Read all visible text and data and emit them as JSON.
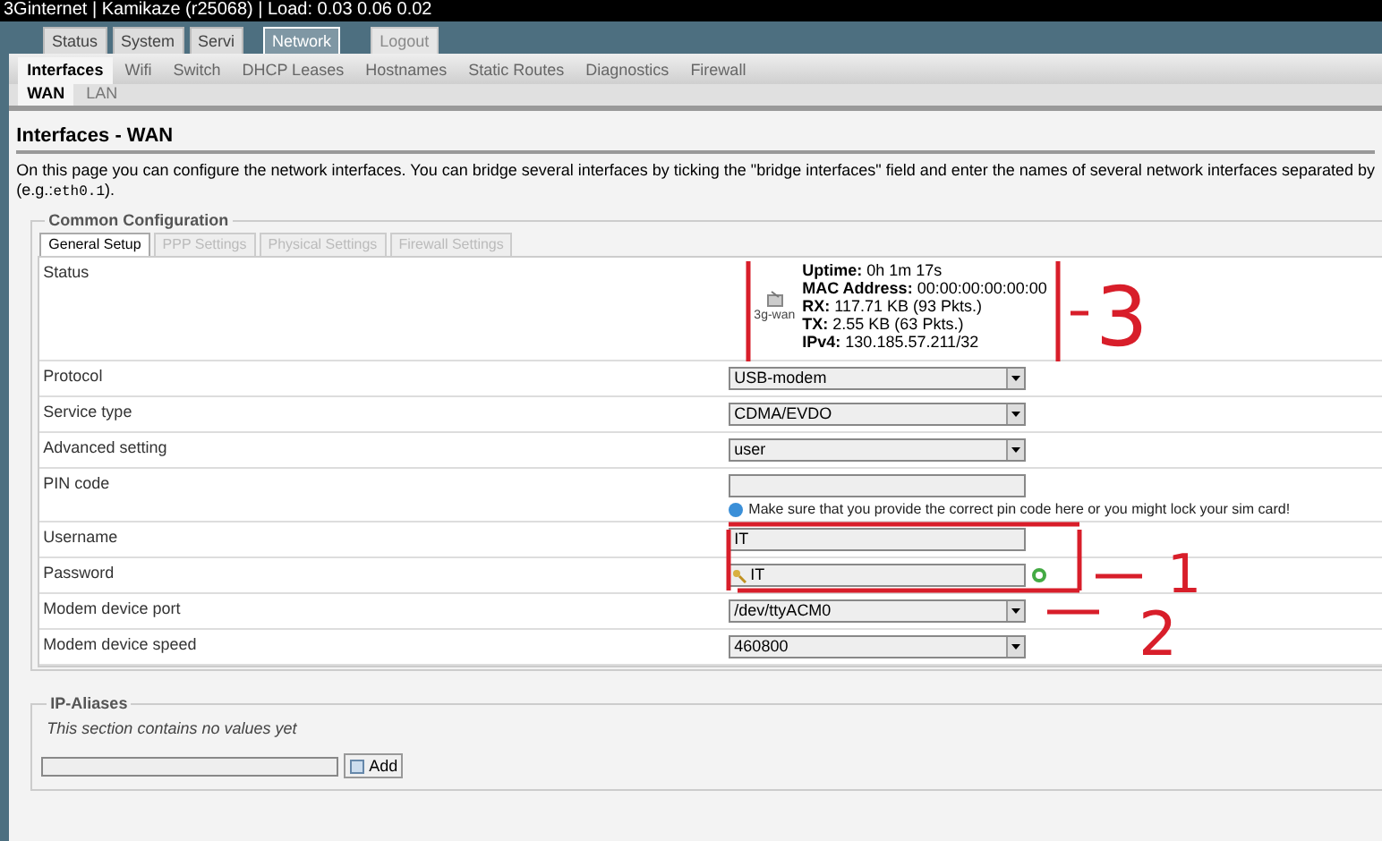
{
  "title_bar": "3Ginternet | Kamikaze (r25068) | Load: 0.03 0.06 0.02",
  "main_tabs": [
    {
      "label": "Status",
      "selected": false,
      "disabled": false
    },
    {
      "label": "System",
      "selected": false,
      "disabled": false
    },
    {
      "label": "Servi",
      "selected": false,
      "disabled": false
    },
    {
      "label": "Network",
      "selected": true,
      "disabled": false
    },
    {
      "label": "Logout",
      "selected": false,
      "disabled": true
    }
  ],
  "sub_tabs": [
    {
      "label": "Interfaces",
      "selected": true
    },
    {
      "label": "Wifi",
      "selected": false
    },
    {
      "label": "Switch",
      "selected": false
    },
    {
      "label": "DHCP Leases",
      "selected": false
    },
    {
      "label": "Hostnames",
      "selected": false
    },
    {
      "label": "Static Routes",
      "selected": false
    },
    {
      "label": "Diagnostics",
      "selected": false
    },
    {
      "label": "Firewall",
      "selected": false
    }
  ],
  "interface_tabs": [
    {
      "label": "WAN",
      "selected": true
    },
    {
      "label": "LAN",
      "selected": false
    }
  ],
  "heading": "Interfaces - WAN",
  "description": {
    "line_1": "On this page you can configure the network interfaces. You can bridge several interfaces by ticking the \"bridge interfaces\" field and enter the names of several network interfaces separated by",
    "line_2_prefix": "(e.g.:",
    "line_2_code": "eth0.1",
    "line_2_suffix": ")."
  },
  "common_configuration": {
    "legend": "Common Configuration",
    "tabs": [
      {
        "label": "General Setup",
        "selected": true,
        "disabled": false
      },
      {
        "label": "PPP Settings",
        "selected": false,
        "disabled": true
      },
      {
        "label": "Physical Settings",
        "selected": false,
        "disabled": true
      },
      {
        "label": "Firewall Settings",
        "selected": false,
        "disabled": true
      }
    ],
    "rows": [
      {
        "kind": "status",
        "label": "Status",
        "interface": "3g-wan",
        "lines": [
          {
            "label": "Uptime:",
            "value": "0h 1m 17s"
          },
          {
            "label": "MAC Address:",
            "value": "00:00:00:00:00:00"
          },
          {
            "label": "RX:",
            "value": "117.71 KB (93 Pkts.)"
          },
          {
            "label": "TX:",
            "value": "2.55 KB (63 Pkts.)"
          },
          {
            "label": "IPv4:",
            "value": "130.185.57.211/32"
          }
        ]
      },
      {
        "kind": "select",
        "label": "Protocol",
        "value": "USB-modem"
      },
      {
        "kind": "select",
        "label": "Service type",
        "value": "CDMA/EVDO"
      },
      {
        "kind": "select",
        "label": "Advanced setting",
        "value": "user"
      },
      {
        "kind": "input",
        "label": "PIN code",
        "hint": "Make sure that you provide the correct pin code here or you might lock your sim card!"
      },
      {
        "kind": "input",
        "label": "Username",
        "value": "IT"
      },
      {
        "kind": "password",
        "label": "Password",
        "value": "IT"
      },
      {
        "kind": "select",
        "label": "Modem device port",
        "value": "/dev/ttyACM0"
      },
      {
        "kind": "select",
        "label": "Modem device speed",
        "value": "460800"
      }
    ]
  },
  "ip_aliases": {
    "legend": "IP-Aliases",
    "empty_text": "This section contains no values yet",
    "add_button": "Add"
  },
  "annotations": [
    "3",
    "1",
    "2"
  ]
}
